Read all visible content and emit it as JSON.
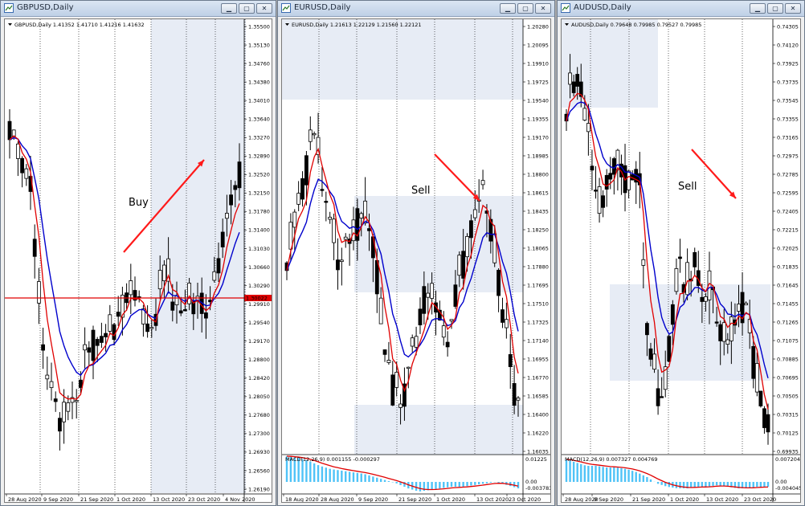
{
  "windows": [
    {
      "id": "gbp",
      "title": "GBPUSD,Daily",
      "header": "GBPUSD,Daily  1.41352 1.41710 1.41216 1.41632",
      "annotation": "Buy",
      "hline_label": "1.30022",
      "price_labels": [
        "1.35500",
        "1.35130",
        "1.34760",
        "1.34380",
        "1.34010",
        "1.33640",
        "1.33270",
        "1.32890",
        "1.32520",
        "1.32150",
        "1.31780",
        "1.31400",
        "1.31030",
        "1.30660",
        "1.30290",
        "1.29910",
        "1.29540",
        "1.29170",
        "1.28800",
        "1.28420",
        "1.28050",
        "1.27680",
        "1.27300",
        "1.26930",
        "1.26560",
        "1.26190"
      ],
      "date_labels": [
        "28 Aug 2020",
        "9 Sep 2020",
        "21 Sep 2020",
        "1 Oct 2020",
        "13 Oct 2020",
        "23 Oct 2020",
        "4 Nov 2020"
      ]
    },
    {
      "id": "eur",
      "title": "EURUSD,Daily",
      "header": "EURUSD,Daily  1.21613 1.22129 1.21560 1.22121",
      "annotation": "Sell",
      "price_labels": [
        "1.20280",
        "1.20095",
        "1.19910",
        "1.19725",
        "1.19540",
        "1.19355",
        "1.19170",
        "1.18985",
        "1.18800",
        "1.18615",
        "1.18435",
        "1.18250",
        "1.18065",
        "1.17880",
        "1.17695",
        "1.17510",
        "1.17325",
        "1.17140",
        "1.16955",
        "1.16770",
        "1.16585",
        "1.16400",
        "1.16220",
        "1.16035"
      ],
      "macd_label": "MACD(12,26,9) 0.001155 -0.000297",
      "macd_levels": [
        "0.01225",
        "0.00",
        "-0.003783"
      ],
      "date_labels": [
        "18 Aug 2020",
        "28 Aug 2020",
        "9 Sep 2020",
        "21 Sep 2020",
        "1 Oct 2020",
        "13 Oct 2020",
        "23 Oct 2020"
      ]
    },
    {
      "id": "aud",
      "title": "AUDUSD,Daily",
      "header": "AUDUSD,Daily  0.79648 0.79985 0.79527 0.79985",
      "annotation": "Sell",
      "price_labels": [
        "0.74305",
        "0.74120",
        "0.73925",
        "0.73735",
        "0.73545",
        "0.73355",
        "0.73165",
        "0.72975",
        "0.72785",
        "0.72595",
        "0.72405",
        "0.72215",
        "0.72025",
        "0.71835",
        "0.71645",
        "0.71455",
        "0.71265",
        "0.71075",
        "0.70885",
        "0.70695",
        "0.70505",
        "0.70315",
        "0.70125",
        "0.69935"
      ],
      "macd_label": "MACD(12,26,9) 0.007327 0.004769",
      "macd_levels": [
        "0.007204",
        "0.00",
        "-0.004045"
      ],
      "date_labels": [
        "28 Aug 2020",
        "9 Sep 2020",
        "21 Sep 2020",
        "1 Oct 2020",
        "13 Oct 2020",
        "23 Oct 2020"
      ]
    }
  ],
  "colors": {
    "bull": "#ffffff",
    "bear": "#000000",
    "ma_fast": "#e00000",
    "ma_slow": "#0000cc",
    "macd_hist": "#4fc3f7",
    "macd_signal": "#e00000",
    "arrow": "#ff1a1a",
    "annotation": "#1a32c8"
  },
  "icons": {
    "minimize": "minimize-icon",
    "maximize": "maximize-icon",
    "close": "close-icon"
  }
}
